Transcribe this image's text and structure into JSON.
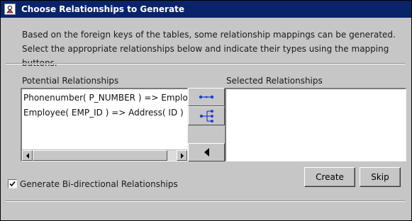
{
  "window": {
    "title": "Choose Relationships to Generate",
    "title_icon": "app-icon"
  },
  "intro": {
    "line1": "Based on the foreign keys of the tables, some relationship mappings can be generated.",
    "line2": "Select the appropriate relationships below and indicate their types using the mapping buttons."
  },
  "potential": {
    "label": "Potential Relationships",
    "items": [
      "Phonenumber( P_NUMBER ) => Employee( EMP_ID )",
      "Employee( EMP_ID ) => Address( ID )"
    ]
  },
  "selected": {
    "label": "Selected Relationships",
    "items": []
  },
  "mapping_buttons": {
    "one_to_one_icon": "one-to-one-mapping-icon",
    "one_to_many_icon": "one-to-many-mapping-icon",
    "remove_icon": "left-arrow-icon"
  },
  "options": {
    "bidirectional_label": "Generate Bi-directional Relationships",
    "bidirectional_checked": true
  },
  "actions": {
    "create_label": "Create",
    "skip_label": "Skip"
  },
  "colors": {
    "titlebar": "#0a246a",
    "dialog_bg": "#c6c6c6",
    "mapping_icon": "#1f3fd0"
  }
}
